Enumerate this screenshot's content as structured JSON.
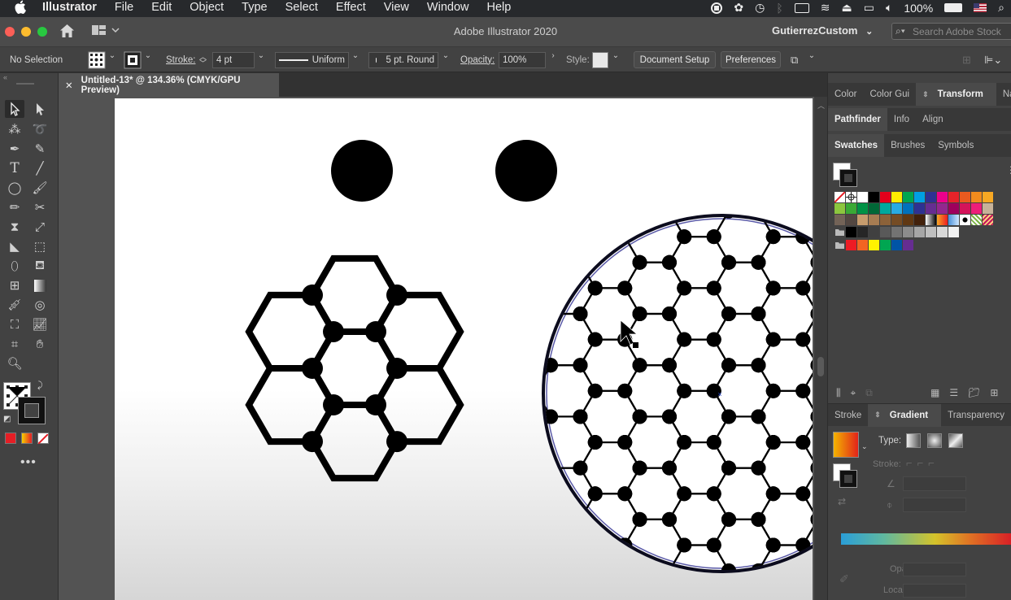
{
  "menubar": {
    "apple_icon": "apple-icon",
    "app_name": "Illustrator",
    "menus": [
      "File",
      "Edit",
      "Object",
      "Type",
      "Select",
      "Effect",
      "View",
      "Window",
      "Help"
    ],
    "battery": "100%",
    "status_icons": [
      "record-icon",
      "fan-icon",
      "time-machine-icon",
      "bluetooth-icon",
      "keyboard-icon",
      "wifi-icon",
      "eject-icon",
      "airplay-icon",
      "volume-icon",
      "battery-icon",
      "flag-icon",
      "search-icon"
    ]
  },
  "titlebar": {
    "title": "Adobe Illustrator 2020",
    "workspace": "GutierrezCustom",
    "search_placeholder": "Search Adobe Stock"
  },
  "control": {
    "selection": "No Selection",
    "stroke_label": "Stroke:",
    "stroke_value": "4 pt",
    "profile": "Uniform",
    "brush": "5 pt. Round",
    "opacity_label": "Opacity:",
    "opacity_value": "100%",
    "style_label": "Style:",
    "doc_setup": "Document Setup",
    "preferences": "Preferences"
  },
  "document": {
    "tab_title": "Untitled-13* @ 134.36% (CMYK/GPU Preview)"
  },
  "panels": {
    "row1": [
      "Color",
      "Color Gui",
      "Transform",
      "Navigat"
    ],
    "row1_active": "Transform",
    "row2": [
      "Pathfinder",
      "Info",
      "Align"
    ],
    "row2_active": "Pathfinder",
    "row3": [
      "Swatches",
      "Brushes",
      "Symbols"
    ],
    "row3_active": "Swatches",
    "row4": [
      "Stroke",
      "Gradient",
      "Transparency"
    ],
    "row4_active": "Gradient",
    "gradient": {
      "type_label": "Type:",
      "stroke_label": "Stroke:",
      "opacity_label": "Opacity:",
      "location_label": "Location:"
    },
    "swatch_colors": [
      [
        "none",
        "reg",
        "#ffffff",
        "#000000",
        "#e3001b",
        "#ffec00",
        "#00a650",
        "#00a0e3",
        "#2e3192",
        "#ec008c",
        "#e52329",
        "#ea5a1f",
        "#f18b1d",
        "#f7a823"
      ],
      [
        "#8cc63e",
        "#3aa935",
        "#009245",
        "#006837",
        "#00a99d",
        "#29abe2",
        "#0071bc",
        "#2e3192",
        "#662d91",
        "#93278f",
        "#9e005d",
        "#d4145a",
        "#ed1e79",
        "#c7b299"
      ],
      [
        "#736357",
        "#534741",
        "#c69c6d",
        "#a67c52",
        "#8c6239",
        "#754c24",
        "#603813",
        "#42210b",
        "grad1",
        "grad2",
        "grad3",
        "pat1",
        "pat2",
        "pat3"
      ],
      [
        "folder",
        "#000000",
        "#262626",
        "#404040",
        "#595959",
        "#737373",
        "#8c8c8c",
        "#a6a6a6",
        "#bfbfbf",
        "#d9d9d9",
        "#f2f2f2"
      ],
      [
        "folder",
        "#ed1c24",
        "#f26522",
        "#fff200",
        "#00a651",
        "#0054a6",
        "#662d91"
      ]
    ]
  }
}
